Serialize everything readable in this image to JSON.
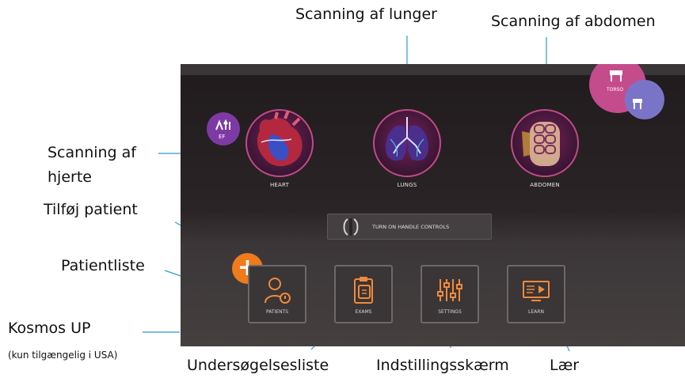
{
  "callouts": {
    "lungs": "Scanning af lunger",
    "abdomen": "Scanning af abdomen",
    "heart_line1": "Scanning af",
    "heart_line2": "hjerte",
    "add_patient": "Tilføj patient",
    "patient_list": "Patientliste",
    "kosmos_up": "Kosmos UP",
    "kosmos_note": "(kun tilgængelig i USA)",
    "exam_list": "Undersøgelsesliste",
    "settings_screen": "Indstillingsskærm",
    "learn": "Lær"
  },
  "screen": {
    "organs": {
      "heart": "HEART",
      "lungs": "LUNGS",
      "abdomen": "ABDOMEN"
    },
    "ef_badge": {
      "icon": "ef-trend-icon",
      "label": "EF"
    },
    "torso_badge": "TORSO",
    "handle_controls": "TURN ON HANDLE CONTROLS",
    "tiles": {
      "patients": "PATIENTS",
      "exams": "EXAMS",
      "settings": "SETTINGS",
      "learn": "LEARN"
    },
    "add_icon": "plus-icon",
    "colors": {
      "accent_orange": "#f07a1c",
      "organ_ring": "#c14a86",
      "ef_purple": "#7d3aa5"
    }
  }
}
